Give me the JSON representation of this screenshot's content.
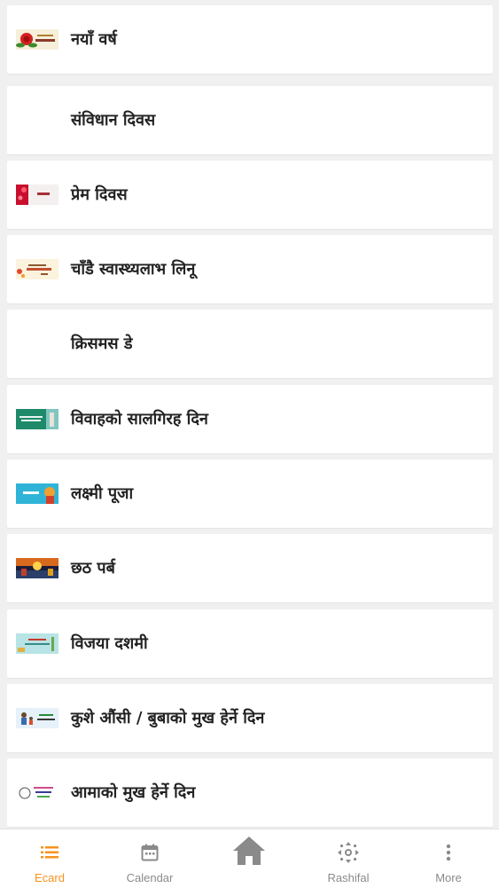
{
  "colors": {
    "accent": "#f7931e",
    "inactive": "#8a8a8a",
    "card_bg": "#ffffff",
    "page_bg": "#f0f0f0"
  },
  "ecards": [
    {
      "title": "नयाँ वर्ष",
      "thumb": "new-year-rose-thumbnail"
    },
    {
      "title": "संविधान दिवस",
      "thumb": ""
    },
    {
      "title": "प्रेम दिवस",
      "thumb": "valentine-thumbnail"
    },
    {
      "title": "चाँडै स्वास्थ्यलाभ लिनू",
      "thumb": "get-well-soon-thumbnail"
    },
    {
      "title": "क्रिसमस डे",
      "thumb": ""
    },
    {
      "title": "विवाहको सालगिरह दिन",
      "thumb": "anniversary-thumbnail"
    },
    {
      "title": "लक्ष्मी पूजा",
      "thumb": "laxmi-puja-thumbnail"
    },
    {
      "title": "छठ पर्ब",
      "thumb": "chhath-thumbnail"
    },
    {
      "title": "विजया दशमी",
      "thumb": "vijaya-dashami-thumbnail"
    },
    {
      "title": "कुशे औंसी / बुबाको मुख हेर्ने दिन",
      "thumb": "fathers-day-thumbnail"
    },
    {
      "title": "आमाको मुख हेर्ने दिन",
      "thumb": "mothers-day-thumbnail"
    }
  ],
  "nav": {
    "ecard": "Ecard",
    "calendar": "Calendar",
    "home": "",
    "rashifal": "Rashifal",
    "more": "More",
    "icons": {
      "ecard": "list-icon",
      "calendar": "calendar-icon",
      "home": "home-icon",
      "rashifal": "zodiac-icon",
      "more": "more-vertical-icon"
    }
  }
}
